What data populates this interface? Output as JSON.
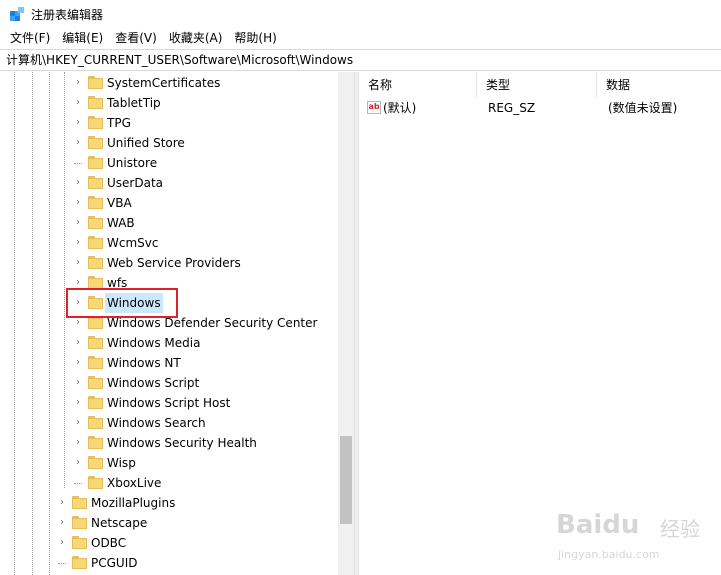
{
  "window": {
    "title": "注册表编辑器"
  },
  "menu": [
    {
      "label": "文件(F)"
    },
    {
      "label": "编辑(E)"
    },
    {
      "label": "查看(V)"
    },
    {
      "label": "收藏夹(A)"
    },
    {
      "label": "帮助(H)"
    }
  ],
  "address": "计算机\\HKEY_CURRENT_USER\\Software\\Microsoft\\Windows",
  "tree": {
    "microsoft_children": [
      {
        "label": "SystemCertificates",
        "expandable": true,
        "selected": false
      },
      {
        "label": "TabletTip",
        "expandable": true,
        "selected": false
      },
      {
        "label": "TPG",
        "expandable": true,
        "selected": false
      },
      {
        "label": "Unified Store",
        "expandable": true,
        "selected": false
      },
      {
        "label": "Unistore",
        "expandable": false,
        "selected": false
      },
      {
        "label": "UserData",
        "expandable": true,
        "selected": false
      },
      {
        "label": "VBA",
        "expandable": true,
        "selected": false
      },
      {
        "label": "WAB",
        "expandable": true,
        "selected": false
      },
      {
        "label": "WcmSvc",
        "expandable": true,
        "selected": false
      },
      {
        "label": "Web Service Providers",
        "expandable": true,
        "selected": false
      },
      {
        "label": "wfs",
        "expandable": true,
        "selected": false
      },
      {
        "label": "Windows",
        "expandable": true,
        "selected": true
      },
      {
        "label": "Windows Defender Security Center",
        "expandable": true,
        "selected": false
      },
      {
        "label": "Windows Media",
        "expandable": true,
        "selected": false
      },
      {
        "label": "Windows NT",
        "expandable": true,
        "selected": false
      },
      {
        "label": "Windows Script",
        "expandable": true,
        "selected": false
      },
      {
        "label": "Windows Script Host",
        "expandable": true,
        "selected": false
      },
      {
        "label": "Windows Search",
        "expandable": true,
        "selected": false
      },
      {
        "label": "Windows Security Health",
        "expandable": true,
        "selected": false
      },
      {
        "label": "Wisp",
        "expandable": true,
        "selected": false
      },
      {
        "label": "XboxLive",
        "expandable": false,
        "selected": false
      }
    ],
    "software_children": [
      {
        "label": "MozillaPlugins",
        "expandable": true
      },
      {
        "label": "Netscape",
        "expandable": true
      },
      {
        "label": "ODBC",
        "expandable": true
      },
      {
        "label": "PCGUID",
        "expandable": false
      }
    ]
  },
  "list": {
    "columns": [
      "名称",
      "类型",
      "数据"
    ],
    "rows": [
      {
        "name": "(默认)",
        "type": "REG_SZ",
        "data": "(数值未设置)",
        "icon": "string-value-icon",
        "icon_text": "ab"
      }
    ]
  },
  "watermark": {
    "brand": "Baidu",
    "brand_cn": "经验",
    "url": "jingyan.baidu.com"
  },
  "colors": {
    "selection": "#cce8ff",
    "highlight_box": "#e0212b",
    "folder": "#f8d775"
  }
}
